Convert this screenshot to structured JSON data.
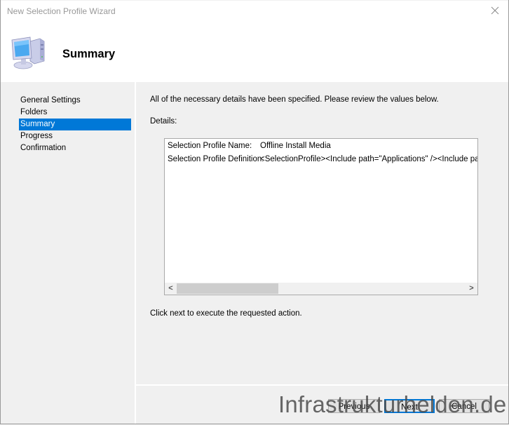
{
  "window": {
    "title": "New Selection Profile Wizard",
    "close_icon": "close-icon"
  },
  "header": {
    "icon": "computer-icon",
    "title": "Summary"
  },
  "sidebar": {
    "items": [
      {
        "label": "General Settings",
        "selected": false
      },
      {
        "label": "Folders",
        "selected": false
      },
      {
        "label": "Summary",
        "selected": true
      },
      {
        "label": "Progress",
        "selected": false
      },
      {
        "label": "Confirmation",
        "selected": false
      }
    ]
  },
  "content": {
    "intro": "All of the necessary details have been specified.  Please review the values below.",
    "details_label": "Details:",
    "details": [
      {
        "key": "Selection Profile Name:",
        "value": "Offline Install Media"
      },
      {
        "key": "Selection Profile Definition:",
        "value": "<SelectionProfile><Include path=\"Applications\" /><Include path=\""
      }
    ],
    "scroll_left_glyph": "<",
    "scroll_right_glyph": ">",
    "footer_note": "Click next to execute the requested action."
  },
  "buttons": {
    "previous": "Previous",
    "next": "Next",
    "cancel": "Cancel"
  },
  "watermark": "Infrastrukturhelden.de",
  "colors": {
    "accent": "#0078d7",
    "background": "#f0f0f0"
  }
}
